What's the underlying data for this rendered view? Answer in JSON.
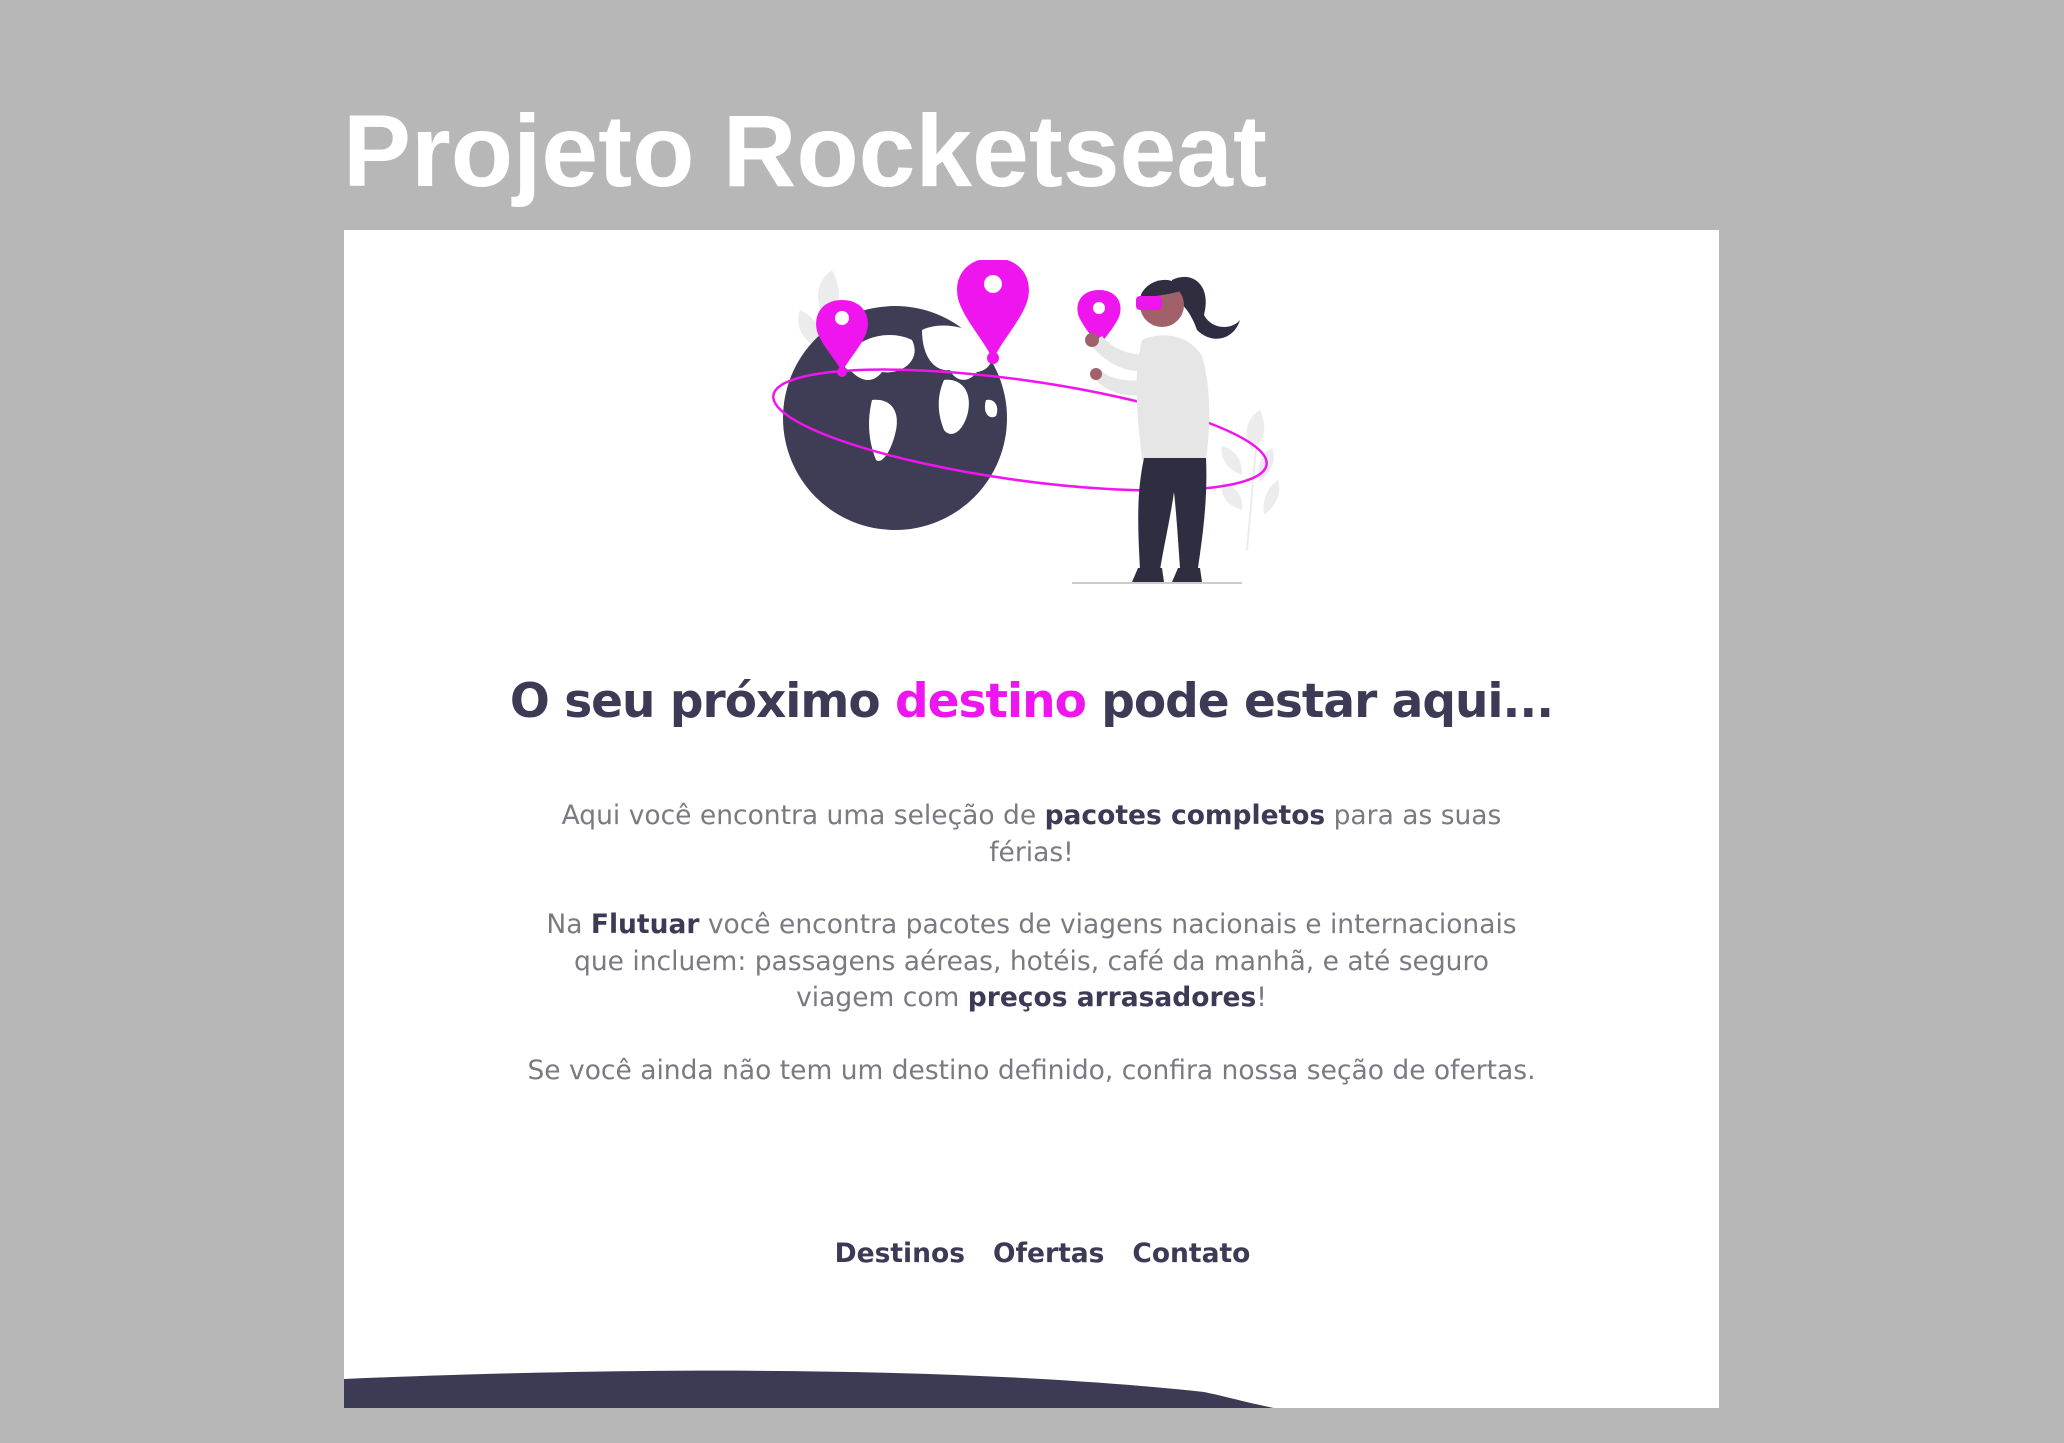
{
  "header": {
    "outer_title": "Projeto Rocketseat"
  },
  "hero": {
    "illustration_icon": "travel-globe-woman-illustration",
    "headline_before": "O seu próximo ",
    "headline_accent": "destino",
    "headline_after": " pode estar aqui..."
  },
  "copy": {
    "p1_before": "Aqui você encontra uma seleção de ",
    "p1_bold": "pacotes completos",
    "p1_after": " para as suas férias!",
    "p2_before": "Na ",
    "p2_bold": "Flutuar",
    "p2_middle": " você encontra pacotes de viagens nacionais e internacionais que incluem: passagens aéreas, hotéis, café da manhã, e até seguro viagem com ",
    "p2_bold2": "preços arrasadores",
    "p2_after": "!",
    "p3": "Se você ainda não tem um destino definido, confira nossa seção de ofertas."
  },
  "menu": {
    "items": [
      {
        "label": "Destinos"
      },
      {
        "label": "Ofertas"
      },
      {
        "label": "Contato"
      }
    ]
  },
  "colors": {
    "background": "#b7b7b7",
    "page": "#ffffff",
    "primary_dark": "#3d3a56",
    "accent_magenta": "#ef15ef",
    "body_text": "#7b7a82"
  }
}
